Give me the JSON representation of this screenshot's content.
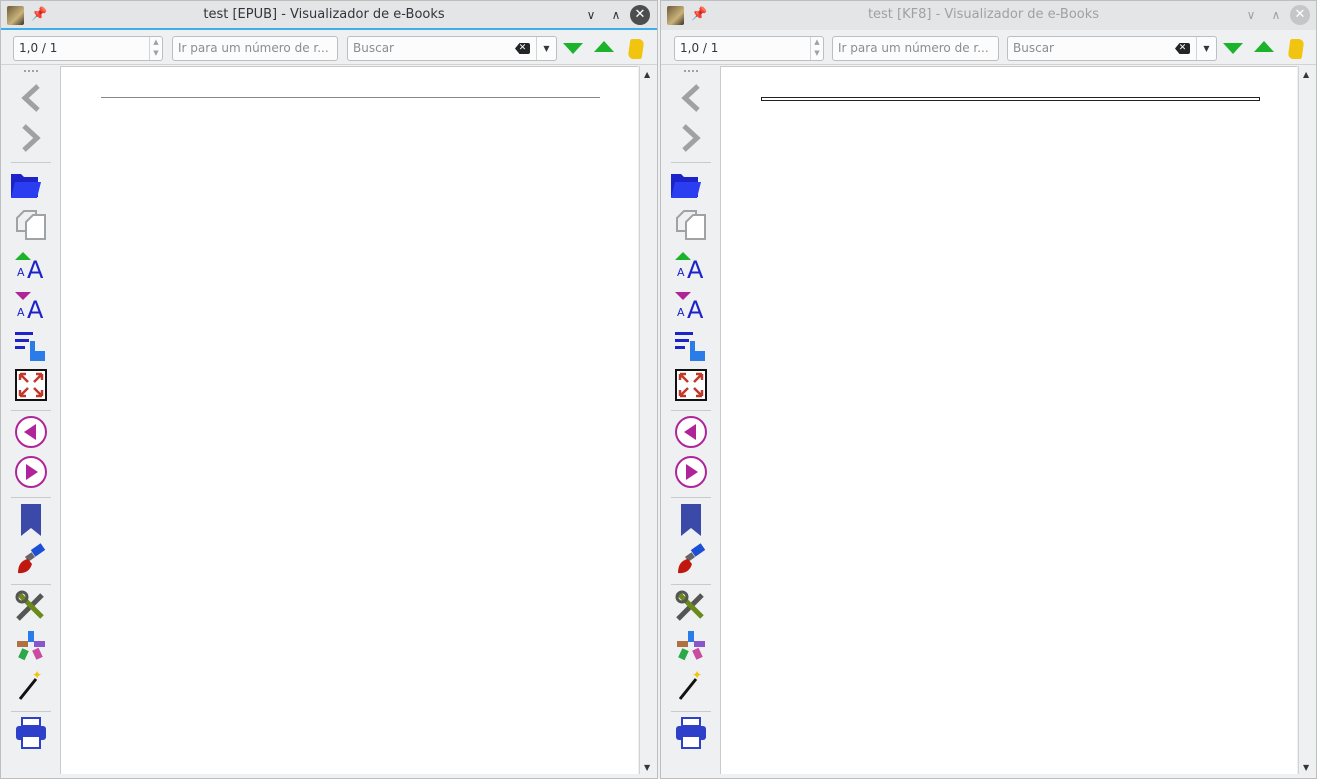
{
  "windows": [
    {
      "title": "test [EPUB] - Visualizador de e-Books",
      "page_position": "1,0 / 1",
      "goto_placeholder": "Ir para um número de r...",
      "search_placeholder": "Buscar"
    },
    {
      "title": "test [KF8] - Visualizador de e-Books",
      "page_position": "1,0 / 1",
      "goto_placeholder": "Ir para um número de r...",
      "search_placeholder": "Buscar"
    }
  ],
  "titlebar_icons": {
    "pin": "📌",
    "minimize": "∨",
    "maximize": "∧",
    "close": "✕"
  },
  "scroll_glyphs": {
    "up": "▲",
    "down": "▼"
  },
  "sidebar_icons": [
    "back-icon",
    "forward-icon",
    "open-ebook-icon",
    "copy-icon",
    "font-larger-icon",
    "font-smaller-icon",
    "toc-icon",
    "fullscreen-icon",
    "previous-page-icon",
    "next-page-icon",
    "bookmark-icon",
    "theme-brush-icon",
    "preferences-icon",
    "reference-mode-icon",
    "lookup-wand-icon",
    "print-icon"
  ],
  "colors": {
    "accent": "#3daee9",
    "search_arrows": "#1bb32a",
    "nav_circle": "#b0249a",
    "bookmark": "#3b4aa8",
    "print": "#2e3fc9"
  }
}
